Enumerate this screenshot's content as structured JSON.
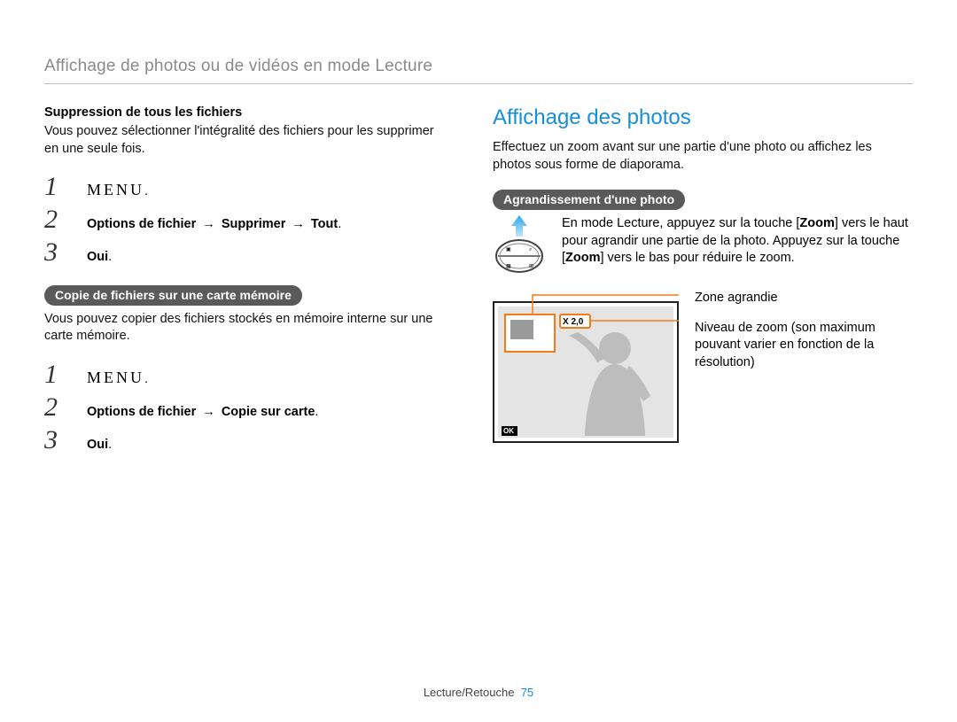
{
  "header": "Affichage de photos ou de vidéos en mode Lecture",
  "left": {
    "delete_sub": "Suppression de tous les fichiers",
    "delete_text": "Vous pouvez sélectionner l'intégralité des fichiers pour les supprimer en une seule fois.",
    "steps_delete": {
      "n1": "1",
      "n2": "2",
      "n3": "3",
      "menu": "MENU",
      "menu_suffix": ".",
      "path_prefix": "Options de fichier",
      "arrow": "→",
      "path_mid": "Supprimer",
      "path_end": "Tout",
      "dot": ".",
      "oui": "Oui"
    },
    "copy_pill": "Copie de fichiers sur une carte mémoire",
    "copy_text": "Vous pouvez copier des fichiers stockés en mémoire interne sur une carte mémoire.",
    "steps_copy": {
      "n1": "1",
      "n2": "2",
      "n3": "3",
      "menu": "MENU",
      "menu_suffix": ".",
      "path_prefix": "Options de fichier",
      "arrow": "→",
      "path_end": "Copie sur carte",
      "dot": ".",
      "oui": "Oui"
    }
  },
  "right": {
    "title": "Affichage des photos",
    "intro": "Effectuez un zoom avant sur une partie d'une photo ou affichez les photos sous forme de diaporama.",
    "zoom_pill": "Agrandissement d'une photo",
    "zoom_text_1": "En mode Lecture, appuyez sur la touche [",
    "zoom_kbd": "Zoom",
    "zoom_text_2": "] vers le haut pour agrandir une partie de la photo. Appuyez sur la touche [",
    "zoom_text_3": "] vers le bas pour réduire le zoom.",
    "fig": {
      "badge": "X 2,0",
      "annot1": "Zone agrandie",
      "annot2": "Niveau de zoom (son maximum pouvant varier en fonction de la résolution)",
      "ok": "OK"
    },
    "button_top_left": "▣",
    "button_top_right": "⌕",
    "button_bot_left": "▦",
    "button_bot_right": "⊞"
  },
  "footer": {
    "section": "Lecture/Retouche",
    "page": "75"
  }
}
